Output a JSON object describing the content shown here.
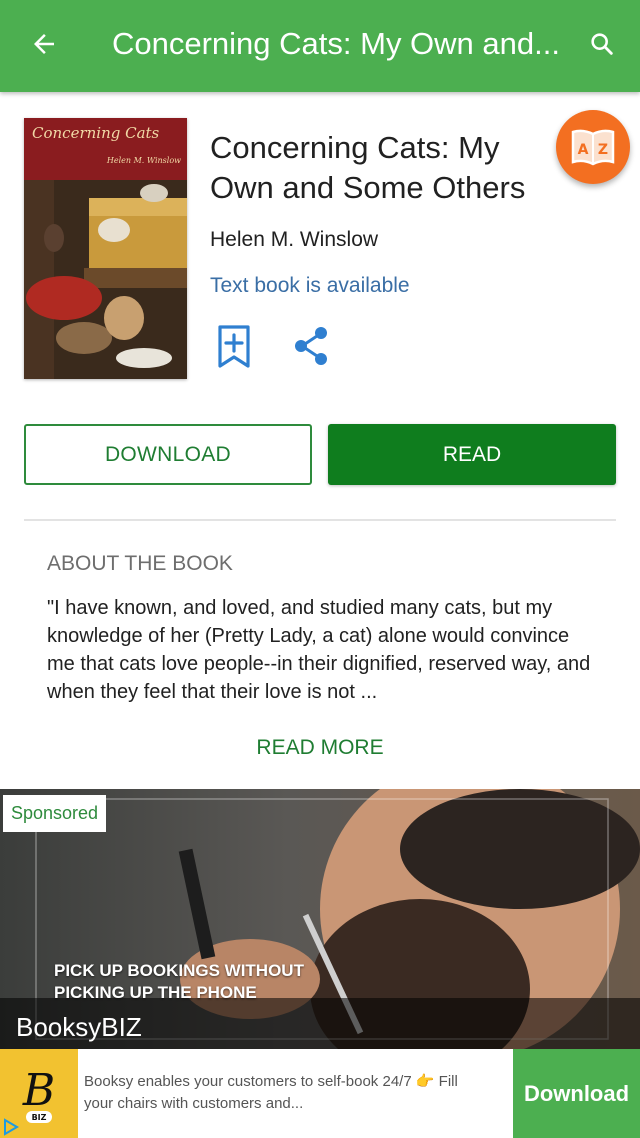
{
  "appbar": {
    "title": "Concerning Cats: My Own and...",
    "back_icon": "arrow-left-icon",
    "search_icon": "search-icon"
  },
  "book": {
    "cover_title": "Concerning Cats",
    "cover_author": "Helen M. Winslow",
    "title": "Concerning Cats: My Own and Some Others",
    "author": "Helen M. Winslow",
    "availability": "Text book is available",
    "bookmark_icon": "bookmark-add-icon",
    "share_icon": "share-icon"
  },
  "fab": {
    "icon": "az-dictionary-icon",
    "letters": [
      "A",
      "Z"
    ]
  },
  "actions": {
    "download_label": "DOWNLOAD",
    "read_label": "READ"
  },
  "about": {
    "heading": "ABOUT THE BOOK",
    "text": "\"I have known, and loved, and studied many cats, but my knowledge of her (Pretty Lady, a cat) alone would convince me that cats love people--in their dignified, reserved way, and when they feel that their love is not ...",
    "read_more": "READ MORE"
  },
  "ad": {
    "sponsored": "Sponsored",
    "headline": "PICK UP BOOKINGS WITHOUT PICKING UP THE PHONE",
    "brand": "BooksyBIZ",
    "description": "Booksy enables your customers to self-book 24/7 👉 Fill your chairs with customers and...",
    "cta": "Download",
    "logo_badge": "BIZ",
    "adchoices_icon": "adchoices-icon"
  },
  "colors": {
    "appbar": "#4caf50",
    "primary_green": "#0f7d1e",
    "link_blue": "#3a6ea5",
    "fab_orange": "#f36f21"
  }
}
